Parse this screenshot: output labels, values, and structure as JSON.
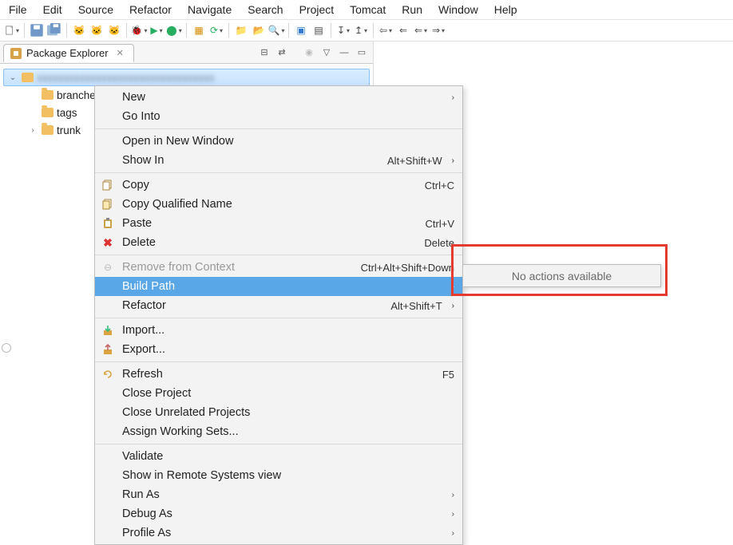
{
  "menu": {
    "items": [
      "File",
      "Edit",
      "Source",
      "Refactor",
      "Navigate",
      "Search",
      "Project",
      "Tomcat",
      "Run",
      "Window",
      "Help"
    ]
  },
  "panel": {
    "title": "Package Explorer"
  },
  "tree": {
    "root": "project-root",
    "items": [
      {
        "label": "branches",
        "expander": ""
      },
      {
        "label": "tags",
        "expander": ""
      },
      {
        "label": "trunk",
        "expander": ">"
      }
    ]
  },
  "context_menu": {
    "groups": [
      [
        {
          "label": "New",
          "submenu": true
        },
        {
          "label": "Go Into"
        }
      ],
      [
        {
          "label": "Open in New Window"
        },
        {
          "label": "Show In",
          "accel": "Alt+Shift+W",
          "submenu": true
        }
      ],
      [
        {
          "label": "Copy",
          "icon": "copy",
          "accel": "Ctrl+C"
        },
        {
          "label": "Copy Qualified Name",
          "icon": "copy-qual"
        },
        {
          "label": "Paste",
          "icon": "paste",
          "accel": "Ctrl+V"
        },
        {
          "label": "Delete",
          "icon": "delete",
          "accel": "Delete"
        }
      ],
      [
        {
          "label": "Remove from Context",
          "icon": "remove-ctx",
          "accel": "Ctrl+Alt+Shift+Down",
          "disabled": true
        },
        {
          "label": "Build Path",
          "submenu": true,
          "highlight": true
        },
        {
          "label": "Refactor",
          "accel": "Alt+Shift+T",
          "submenu": true
        }
      ],
      [
        {
          "label": "Import...",
          "icon": "import"
        },
        {
          "label": "Export...",
          "icon": "export"
        }
      ],
      [
        {
          "label": "Refresh",
          "icon": "refresh",
          "accel": "F5"
        },
        {
          "label": "Close Project"
        },
        {
          "label": "Close Unrelated Projects"
        },
        {
          "label": "Assign Working Sets..."
        }
      ],
      [
        {
          "label": "Validate"
        },
        {
          "label": "Show in Remote Systems view"
        },
        {
          "label": "Run As",
          "submenu": true
        },
        {
          "label": "Debug As",
          "submenu": true
        },
        {
          "label": "Profile As",
          "submenu": true
        }
      ]
    ]
  },
  "submenu_popup": {
    "message": "No actions available"
  }
}
